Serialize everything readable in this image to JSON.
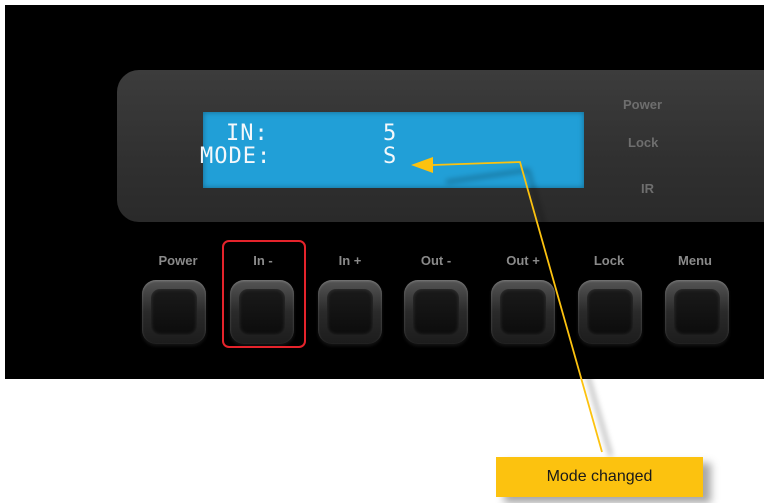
{
  "lcd": {
    "line1_key": "IN:",
    "line1_value": "5",
    "line2_key": "MODE:",
    "line2_value": "S"
  },
  "indicators": {
    "power": "Power",
    "lock": "Lock",
    "ir": "IR"
  },
  "buttons": [
    {
      "label": "Power"
    },
    {
      "label": "In -"
    },
    {
      "label": "In +"
    },
    {
      "label": "Out -"
    },
    {
      "label": "Out +"
    },
    {
      "label": "Lock"
    },
    {
      "label": "Menu"
    }
  ],
  "callout": {
    "text": "Mode changed"
  },
  "colors": {
    "lcd_background": "#219fd7",
    "highlight_border": "#e5232b",
    "callout_background": "#fcc20f",
    "arrow": "#fcc20f"
  }
}
